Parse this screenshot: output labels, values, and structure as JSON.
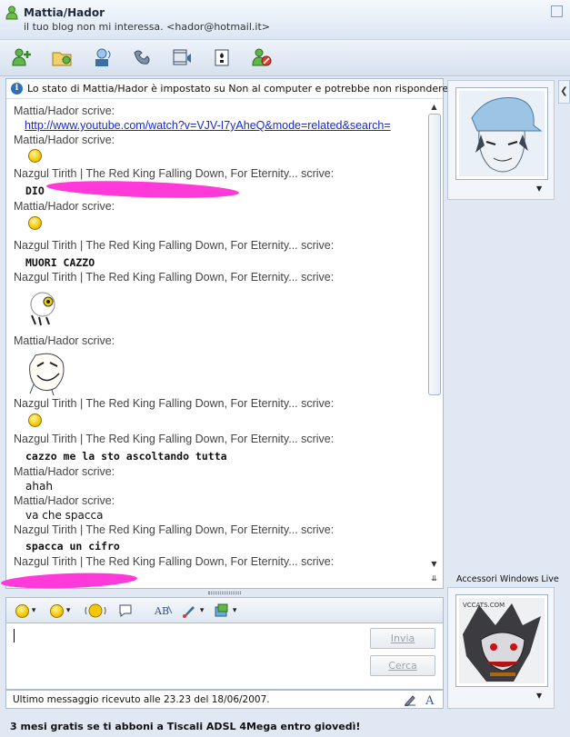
{
  "window": {
    "contact_name": "Mattia/Hador",
    "contact_subtitle": "il tuo blog non mi interessa.  <hador@hotmail.it>"
  },
  "toolbar": {
    "items": [
      {
        "name": "invite-contact-icon"
      },
      {
        "name": "send-files-icon"
      },
      {
        "name": "video-call-icon"
      },
      {
        "name": "voice-call-icon"
      },
      {
        "name": "activities-icon"
      },
      {
        "name": "games-icon"
      },
      {
        "name": "block-contact-icon"
      }
    ]
  },
  "info_bar": {
    "text": "Lo stato di Mattia/Hador è impostato su Non al computer e potrebbe non rispondere."
  },
  "conversation": {
    "header_1": "Mattia/Hador scrive:",
    "link_1": "http://www.youtube.com/watch?v=VJV-I7yAheQ&mode=related&search=",
    "header_2": "Mattia/Hador scrive:",
    "header_3": "Nazgul Tirith | The Red King Falling Down, For Eternity... scrive:",
    "body_3": "DIO",
    "header_4": "Mattia/Hador scrive:",
    "header_5": "Nazgul Tirith | The Red King Falling Down, For Eternity... scrive:",
    "body_5": "MUORI CAZZO",
    "header_6": "Nazgul Tirith | The Red King Falling Down, For Eternity... scrive:",
    "header_7": "Mattia/Hador scrive:",
    "header_8": "Nazgul Tirith | The Red King Falling Down, For Eternity... scrive:",
    "header_9": "Nazgul Tirith | The Red King Falling Down, For Eternity... scrive:",
    "body_9": "cazzo me la sto ascoltando tutta",
    "header_10": "Mattia/Hador scrive:",
    "body_10": "ahah",
    "header_11": "Mattia/Hador scrive:",
    "body_11": "va che spacca",
    "header_12": "Nazgul Tirith | The Red King Falling Down, For Eternity... scrive:",
    "body_12": "spacca un cifro",
    "header_13": "Nazgul Tirith | The Red King Falling Down, For Eternity... scrive:"
  },
  "editor": {
    "send_label": "Invia",
    "search_label": "Cerca"
  },
  "status": {
    "last_message": "Ultimo messaggio ricevuto alle 23.23 del 18/06/2007."
  },
  "side": {
    "accessories_label": "Accessori Windows Live",
    "ad_image_text": "VCCATS.COM"
  },
  "ad": {
    "text": "3 mesi gratis se ti abboni a Tiscali ADSL 4Mega entro giovedì!"
  },
  "colors": {
    "link": "#1a2ad0",
    "redaction": "#ff2fd6",
    "frame": "#dfe8f3"
  }
}
